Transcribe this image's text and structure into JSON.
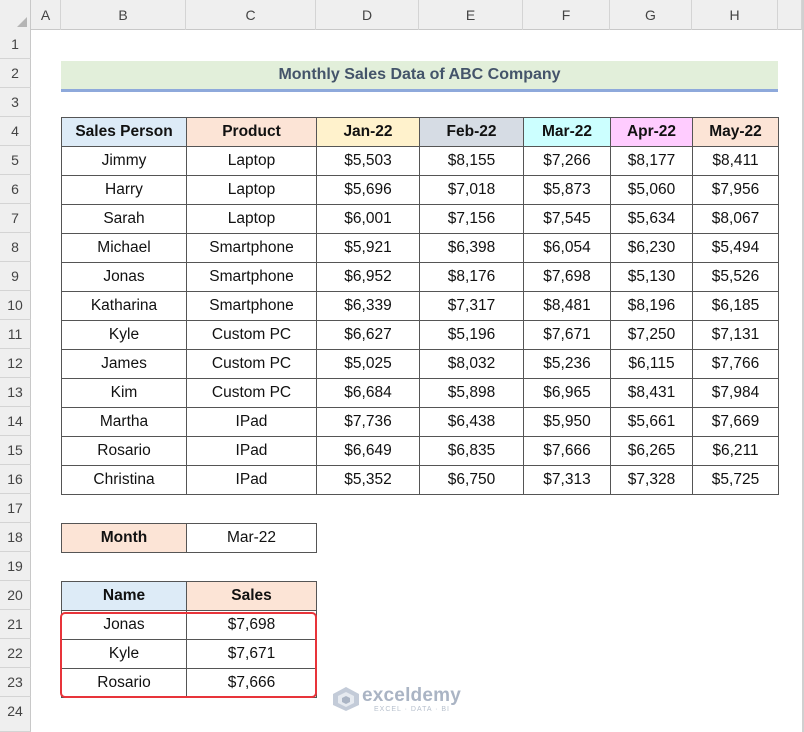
{
  "columns": [
    "A",
    "B",
    "C",
    "D",
    "E",
    "F",
    "G",
    "H"
  ],
  "rows": [
    "1",
    "2",
    "3",
    "4",
    "5",
    "6",
    "7",
    "8",
    "9",
    "10",
    "11",
    "12",
    "13",
    "14",
    "15",
    "16",
    "17",
    "18",
    "19",
    "20",
    "21",
    "22",
    "23",
    "24"
  ],
  "title": "Monthly Sales Data of ABC Company",
  "table": {
    "headers": [
      "Sales Person",
      "Product",
      "Jan-22",
      "Feb-22",
      "Mar-22",
      "Apr-22",
      "May-22"
    ],
    "rows": [
      [
        "Jimmy",
        "Laptop",
        "$5,503",
        "$8,155",
        "$7,266",
        "$8,177",
        "$8,411"
      ],
      [
        "Harry",
        "Laptop",
        "$5,696",
        "$7,018",
        "$5,873",
        "$5,060",
        "$7,956"
      ],
      [
        "Sarah",
        "Laptop",
        "$6,001",
        "$7,156",
        "$7,545",
        "$5,634",
        "$8,067"
      ],
      [
        "Michael",
        "Smartphone",
        "$5,921",
        "$6,398",
        "$6,054",
        "$6,230",
        "$5,494"
      ],
      [
        "Jonas",
        "Smartphone",
        "$6,952",
        "$8,176",
        "$7,698",
        "$5,130",
        "$5,526"
      ],
      [
        "Katharina",
        "Smartphone",
        "$6,339",
        "$7,317",
        "$8,481",
        "$8,196",
        "$6,185"
      ],
      [
        "Kyle",
        "Custom PC",
        "$6,627",
        "$5,196",
        "$7,671",
        "$7,250",
        "$7,131"
      ],
      [
        "James",
        "Custom PC",
        "$5,025",
        "$8,032",
        "$5,236",
        "$6,115",
        "$7,766"
      ],
      [
        "Kim",
        "Custom PC",
        "$6,684",
        "$5,898",
        "$6,965",
        "$8,431",
        "$7,984"
      ],
      [
        "Martha",
        "IPad",
        "$7,736",
        "$6,438",
        "$5,950",
        "$5,661",
        "$7,669"
      ],
      [
        "Rosario",
        "IPad",
        "$6,649",
        "$6,835",
        "$7,666",
        "$6,265",
        "$6,211"
      ],
      [
        "Christina",
        "IPad",
        "$5,352",
        "$6,750",
        "$7,313",
        "$7,328",
        "$5,725"
      ]
    ]
  },
  "criteria": {
    "label": "Month",
    "value": "Mar-22"
  },
  "result": {
    "headers": [
      "Name",
      "Sales"
    ],
    "rows": [
      [
        "Jonas",
        "$7,698"
      ],
      [
        "Kyle",
        "$7,671"
      ],
      [
        "Rosario",
        "$7,666"
      ]
    ]
  },
  "watermark": {
    "name": "exceldemy",
    "tagline": "EXCEL · DATA · BI"
  },
  "colors": {
    "header_sales_person": "#ddebf7",
    "header_product": "#fce4d6",
    "header_jan": "#fff2cc",
    "header_feb": "#d6dce4",
    "header_mar": "#ccffff",
    "header_apr": "#ffccff",
    "header_may": "#fce4d6",
    "title_bg": "#e2efda",
    "title_text": "#44546a",
    "highlight": "#e8343a"
  }
}
